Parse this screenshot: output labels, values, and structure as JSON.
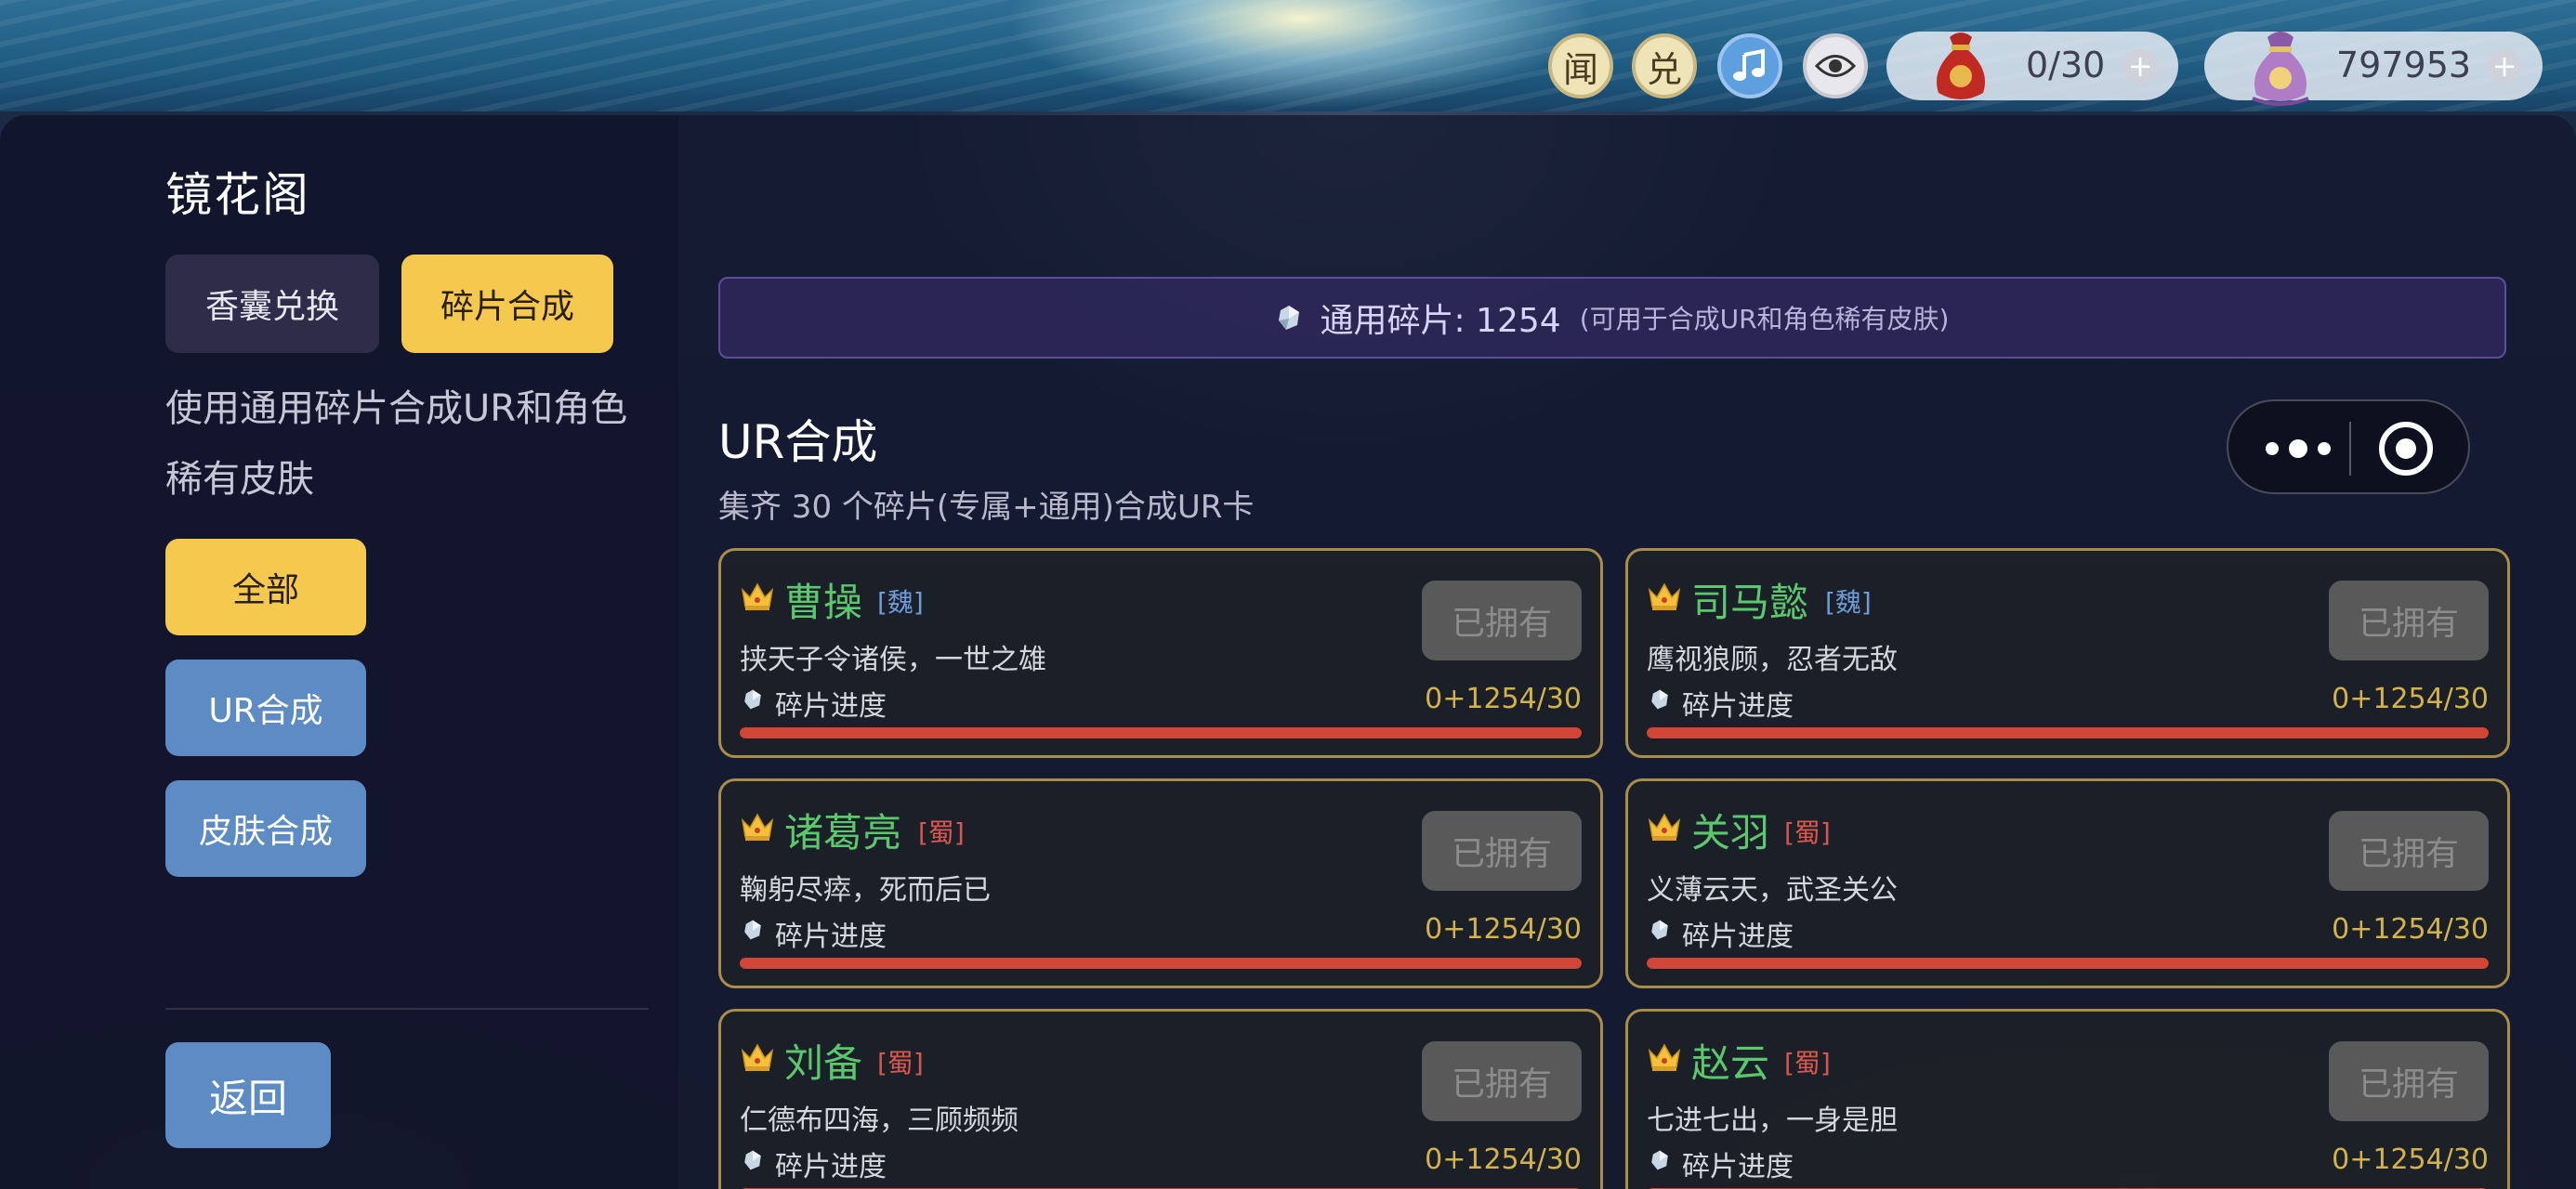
{
  "hud": {
    "news_label": "闻",
    "exchange_label": "兑",
    "music_icon": "music-note-icon",
    "eye_icon": "eye-icon",
    "bag_count": "0/30",
    "coin_count": "797953",
    "plus": "+"
  },
  "sidebar": {
    "title": "镜花阁",
    "tabs": [
      {
        "label": "香囊兑换",
        "active": false
      },
      {
        "label": "碎片合成",
        "active": true
      }
    ],
    "description": "使用通用碎片合成UR和角色稀有皮肤",
    "filters": [
      {
        "label": "全部",
        "active": true
      },
      {
        "label": "UR合成",
        "active": false
      },
      {
        "label": "皮肤合成",
        "active": false
      }
    ],
    "back_label": "返回"
  },
  "banner": {
    "main": "通用碎片: 1254",
    "sub": "(可用于合成UR和角色稀有皮肤)"
  },
  "section": {
    "title": "UR合成",
    "subtitle": "集齐 30 个碎片(专属+通用)合成UR卡"
  },
  "colors": {
    "accent_yellow": "#f5c84e",
    "button_blue": "#5d8cc4",
    "name_green": "#5cc86e",
    "wei_blue": "#6f9bd8",
    "shu_red": "#d9574e",
    "progress_red": "#d24637",
    "count_gold": "#d4b24a"
  },
  "cards": [
    {
      "name": "曹操",
      "faction": "[魏]",
      "motto": "挟天子令诸侯，一世之雄",
      "progress_label": "碎片进度",
      "count": "0+1254/30",
      "progress": 1.0,
      "button": "已拥有"
    },
    {
      "name": "司马懿",
      "faction": "[魏]",
      "motto": "鹰视狼顾，忍者无敌",
      "progress_label": "碎片进度",
      "count": "0+1254/30",
      "progress": 1.0,
      "button": "已拥有"
    },
    {
      "name": "诸葛亮",
      "faction": "[蜀]",
      "motto": "鞠躬尽瘁，死而后已",
      "progress_label": "碎片进度",
      "count": "0+1254/30",
      "progress": 1.0,
      "button": "已拥有"
    },
    {
      "name": "关羽",
      "faction": "[蜀]",
      "motto": "义薄云天，武圣关公",
      "progress_label": "碎片进度",
      "count": "0+1254/30",
      "progress": 1.0,
      "button": "已拥有"
    },
    {
      "name": "刘备",
      "faction": "[蜀]",
      "motto": "仁德布四海，三顾频频",
      "progress_label": "碎片进度",
      "count": "0+1254/30",
      "progress": 1.0,
      "button": "已拥有"
    },
    {
      "name": "赵云",
      "faction": "[蜀]",
      "motto": "七进七出，一身是胆",
      "progress_label": "碎片进度",
      "count": "0+1254/30",
      "progress": 1.0,
      "button": "已拥有"
    }
  ]
}
